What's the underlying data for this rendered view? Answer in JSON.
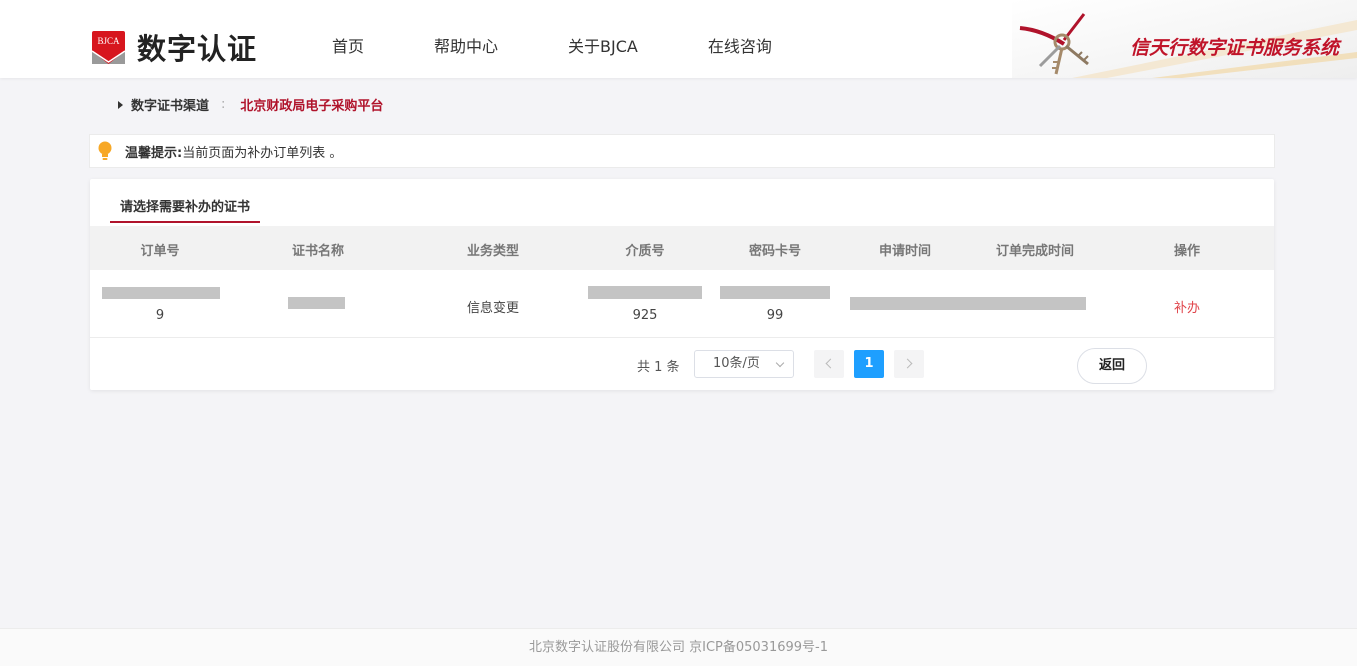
{
  "header": {
    "logo_badge_text": "BJCA",
    "logo_text": "数字认证",
    "nav": [
      "首页",
      "帮助中心",
      "关于BJCA",
      "在线咨询"
    ],
    "banner_text": "信天行数字证书服务系统"
  },
  "breadcrumb": {
    "label": "数字证书渠道",
    "separator": ":",
    "current": "北京财政局电子采购平台"
  },
  "tip": {
    "label": "温馨提示:",
    "text": "当前页面为补办订单列表 。"
  },
  "card": {
    "tab_label": "请选择需要补办的证书",
    "columns": [
      "订单号",
      "证书名称",
      "业务类型",
      "介质号",
      "密码卡号",
      "申请时间",
      "订单完成时间",
      "操作"
    ],
    "row": {
      "order_no_tail": "9",
      "business_type": "信息变更",
      "medium_no_tail": "925",
      "card_no_tail": "99",
      "action": "补办"
    }
  },
  "pagination": {
    "total_text": "共 1 条",
    "page_size": "10条/页",
    "current_page": "1",
    "back_label": "返回"
  },
  "footer": {
    "text": "北京数字认证股份有限公司 京ICP备05031699号-1"
  },
  "colors": {
    "brand_red": "#b0132b",
    "action_red": "#e0454b",
    "page_blue": "#1e9fff"
  }
}
